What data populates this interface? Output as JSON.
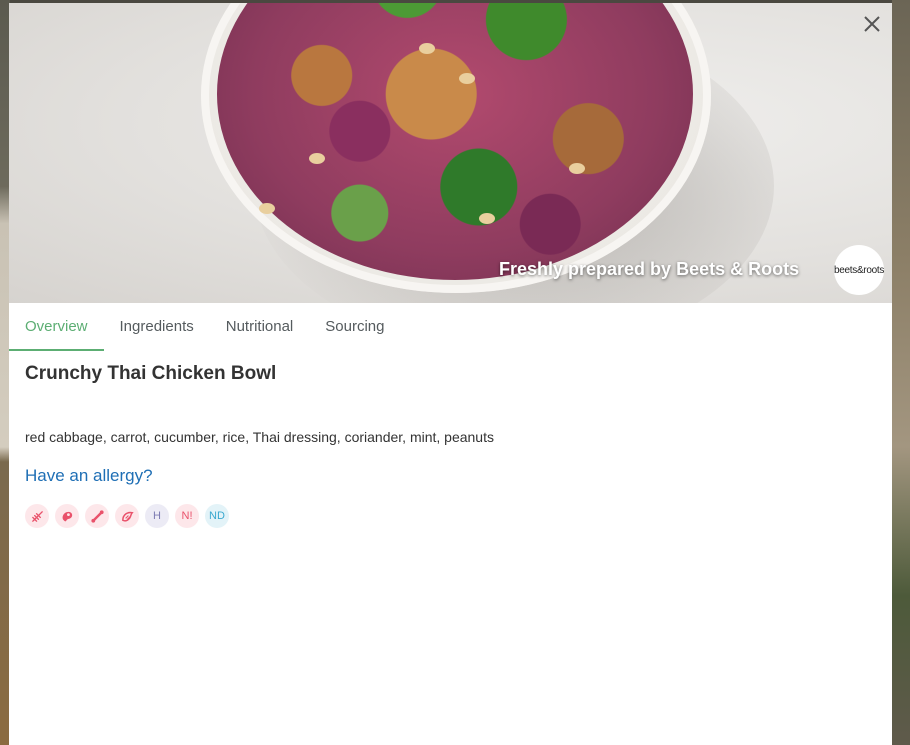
{
  "hero": {
    "caption": "Freshly prepared by Beets & Roots",
    "brand_logo_text": "beets &roots"
  },
  "tabs": [
    {
      "label": "Overview",
      "active": true
    },
    {
      "label": "Ingredients",
      "active": false
    },
    {
      "label": "Nutritional",
      "active": false
    },
    {
      "label": "Sourcing",
      "active": false
    }
  ],
  "product": {
    "title": "Crunchy Thai Chicken Bowl",
    "ingredients": "red cabbage, carrot, cucumber, rice, Thai dressing, coriander, mint, peanuts",
    "allergy_link": "Have an allergy?"
  },
  "badges": [
    {
      "icon": "wheat-icon",
      "text": ""
    },
    {
      "icon": "meat-icon",
      "text": ""
    },
    {
      "icon": "bone-icon",
      "text": ""
    },
    {
      "icon": "shrimp-icon",
      "text": ""
    },
    {
      "icon": "halal-icon",
      "text": "H"
    },
    {
      "icon": "nuts-icon",
      "text": "N!"
    },
    {
      "icon": "no-dairy-icon",
      "text": "ND"
    }
  ],
  "colors": {
    "accent": "#5cae73",
    "link": "#1f6fb5",
    "badge_red": "#e9526b"
  }
}
